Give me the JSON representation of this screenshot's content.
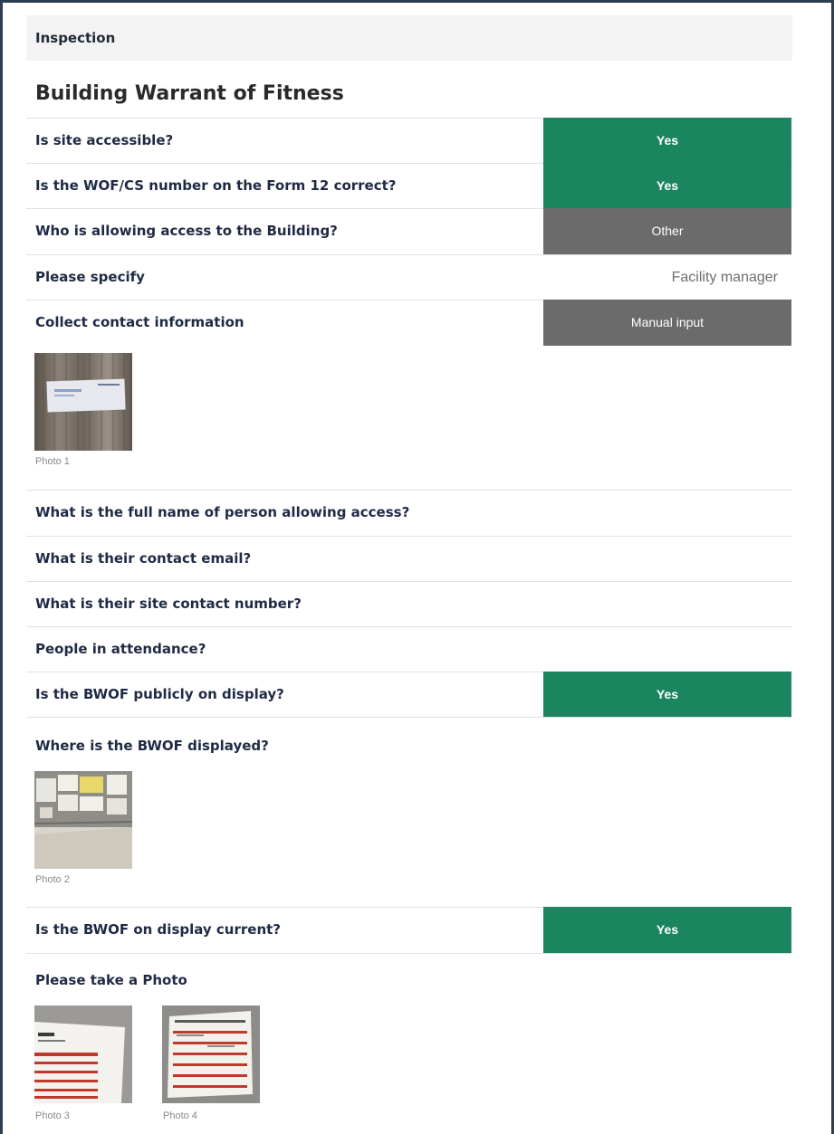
{
  "section": {
    "title": "Inspection"
  },
  "page_title": "Building Warrant of Fitness",
  "questions": [
    {
      "label": "Is site accessible?",
      "answer": "Yes"
    },
    {
      "label": "Is the WOF/CS number on the Form 12 correct?",
      "answer": "Yes"
    },
    {
      "label": "Who is allowing access to the Building?",
      "answer": "Other"
    },
    {
      "label": "Please specify",
      "answer": "Facility manager"
    },
    {
      "label": "Collect contact information",
      "answer": "Manual input"
    },
    {
      "label": "What is the full name of person allowing access?"
    },
    {
      "label": "What is their contact email?"
    },
    {
      "label": "What is their site contact number?"
    },
    {
      "label": "People in attendance?"
    },
    {
      "label": "Is the BWOF publicly on display?",
      "answer": "Yes"
    },
    {
      "label": "Where is the BWOF displayed?"
    },
    {
      "label": "Is the BWOF on display current?",
      "answer": "Yes"
    },
    {
      "label": "Please take a Photo"
    }
  ],
  "photos": [
    "Photo 1",
    "Photo 2",
    "Photo 3",
    "Photo 4"
  ],
  "colors": {
    "answer_positive": "#1b8560",
    "answer_neutral": "#6b6b6b",
    "header_bg": "#f3f3f3",
    "frame": "#2c3e50"
  }
}
